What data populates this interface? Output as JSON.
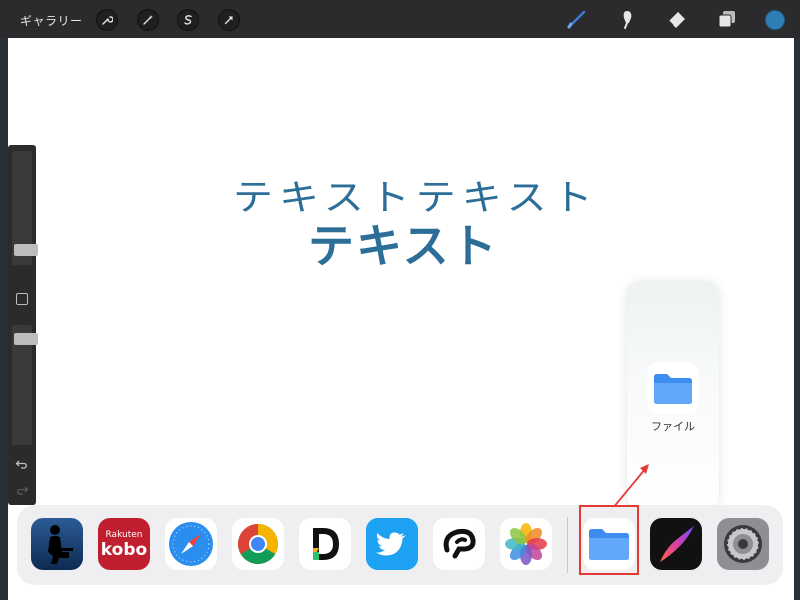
{
  "toolbar": {
    "gallery_label": "ギャラリー",
    "left_tools": [
      "wrench-icon",
      "magic-wand-icon",
      "selection-icon",
      "transform-arrow-icon"
    ],
    "right_tools": [
      "brush-icon",
      "smudge-icon",
      "eraser-icon",
      "layers-icon"
    ],
    "current_color": "#2f7fb5"
  },
  "canvas": {
    "text_line1": "テキストテキスト",
    "text_line2": "テキスト",
    "text_color": "#2c6e97"
  },
  "slideover": {
    "app_label": "ファイル"
  },
  "dock": {
    "apps": [
      "kindle-icon",
      "rakuten-kobo-icon",
      "safari-icon",
      "chrome-icon",
      "day-one-icon",
      "twitter-icon",
      "clip-studio-icon",
      "photos-icon",
      "files-icon",
      "procreate-icon",
      "settings-icon"
    ],
    "kobo_line1": "Rakuten",
    "kobo_line2": "kobo"
  },
  "annotation": {
    "highlight_color": "#e53935"
  }
}
